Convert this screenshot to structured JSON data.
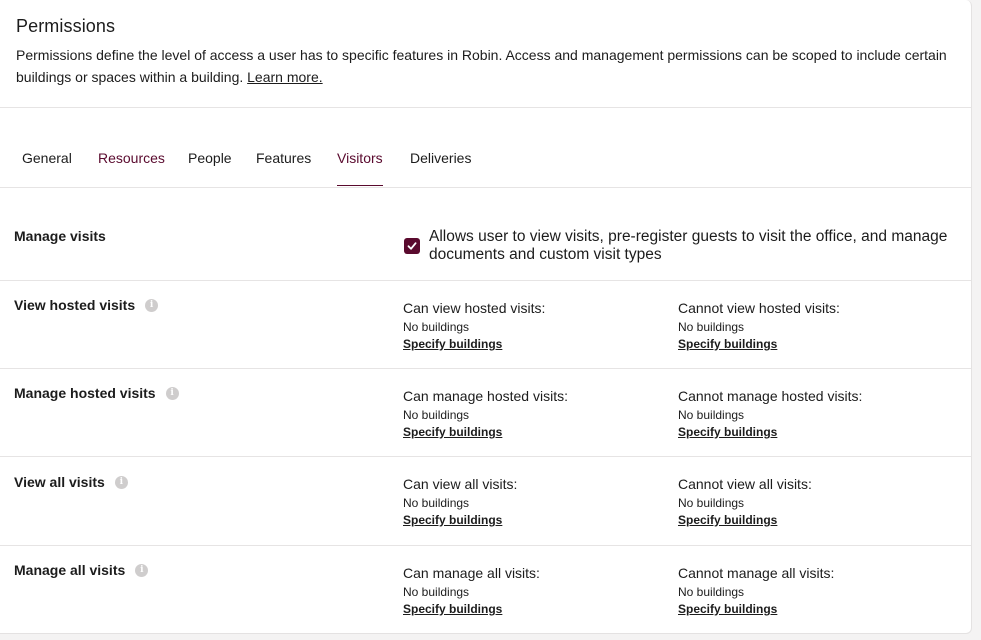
{
  "header": {
    "title": "Permissions",
    "description": "Permissions define the level of access a user has to specific features in Robin. Access and management permissions can be scoped to include certain buildings or spaces within a building.",
    "learn_more": "Learn more."
  },
  "tabs": [
    {
      "label": "General"
    },
    {
      "label": "Resources"
    },
    {
      "label": "People"
    },
    {
      "label": "Features"
    },
    {
      "label": "Visitors",
      "active": true
    },
    {
      "label": "Deliveries"
    }
  ],
  "manage_visits": {
    "label": "Manage visits",
    "checked": true,
    "text": "Allows user to view visits, pre-register guests to visit the office, and manage documents and custom visit types"
  },
  "permissions": [
    {
      "label": "View hosted visits",
      "can": {
        "title": "Can view hosted visits:",
        "value": "No buildings",
        "link": "Specify buildings"
      },
      "cannot": {
        "title": "Cannot view hosted visits:",
        "value": "No buildings",
        "link": "Specify buildings"
      }
    },
    {
      "label": "Manage hosted visits",
      "can": {
        "title": "Can manage hosted visits:",
        "value": "No buildings",
        "link": "Specify buildings"
      },
      "cannot": {
        "title": "Cannot manage hosted visits:",
        "value": "No buildings",
        "link": "Specify buildings"
      }
    },
    {
      "label": "View all visits",
      "can": {
        "title": "Can view all visits:",
        "value": "No buildings",
        "link": "Specify buildings"
      },
      "cannot": {
        "title": "Cannot view all visits:",
        "value": "No buildings",
        "link": "Specify buildings"
      }
    },
    {
      "label": "Manage all visits",
      "can": {
        "title": "Can manage all visits:",
        "value": "No buildings",
        "link": "Specify buildings"
      },
      "cannot": {
        "title": "Cannot manage all visits:",
        "value": "No buildings",
        "link": "Specify buildings"
      }
    }
  ],
  "colors": {
    "accent": "#5a0a2e",
    "border": "#e6e4e4",
    "info_icon": "#cfcdcd"
  }
}
